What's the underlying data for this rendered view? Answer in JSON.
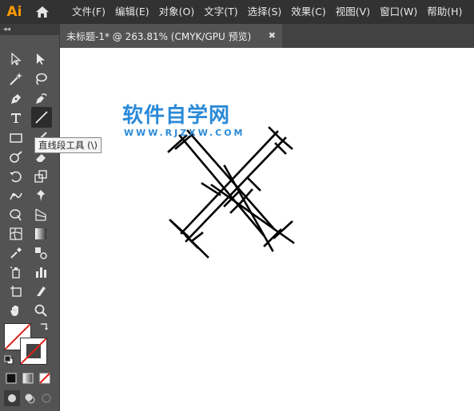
{
  "app": {
    "logo_text": "Ai"
  },
  "menu": [
    "文件(F)",
    "编辑(E)",
    "对象(O)",
    "文字(T)",
    "选择(S)",
    "效果(C)",
    "视图(V)",
    "窗口(W)",
    "帮助(H)"
  ],
  "tab": {
    "collapse_label": "◂◂",
    "title": "未标题-1* @ 263.81% (CMYK/GPU 预览)",
    "close_label": "✖"
  },
  "tooltip": "直线段工具 (\\)",
  "watermark": {
    "title": "软件自学网",
    "url": "WWW.RJZXW.COM"
  },
  "tools": [
    {
      "name": "selection-tool-icon"
    },
    {
      "name": "direct-selection-tool-icon"
    },
    {
      "name": "magic-wand-tool-icon"
    },
    {
      "name": "lasso-tool-icon"
    },
    {
      "name": "pen-tool-icon"
    },
    {
      "name": "curvature-tool-icon"
    },
    {
      "name": "type-tool-icon"
    },
    {
      "name": "line-segment-tool-icon",
      "active": true
    },
    {
      "name": "rectangle-tool-icon"
    },
    {
      "name": "paintbrush-tool-icon"
    },
    {
      "name": "shaper-tool-icon"
    },
    {
      "name": "eraser-tool-icon"
    },
    {
      "name": "rotate-tool-icon"
    },
    {
      "name": "scale-tool-icon"
    },
    {
      "name": "puppet-warp-tool-icon"
    },
    {
      "name": "free-transform-tool-icon"
    },
    {
      "name": "shape-builder-tool-icon"
    },
    {
      "name": "perspective-grid-tool-icon"
    },
    {
      "name": "mesh-tool-icon"
    },
    {
      "name": "gradient-tool-icon"
    },
    {
      "name": "eyedropper-tool-icon"
    },
    {
      "name": "blend-tool-icon"
    },
    {
      "name": "symbol-sprayer-tool-icon"
    },
    {
      "name": "column-graph-tool-icon"
    },
    {
      "name": "artboard-tool-icon"
    },
    {
      "name": "slice-tool-icon"
    },
    {
      "name": "hand-tool-icon"
    },
    {
      "name": "zoom-tool-icon"
    }
  ],
  "colors": {
    "fill": "#ffffff",
    "stroke": "#000000",
    "none_slash": "#e0201a",
    "watermark": "#2a8ad8",
    "logo": "#ff9a00"
  }
}
